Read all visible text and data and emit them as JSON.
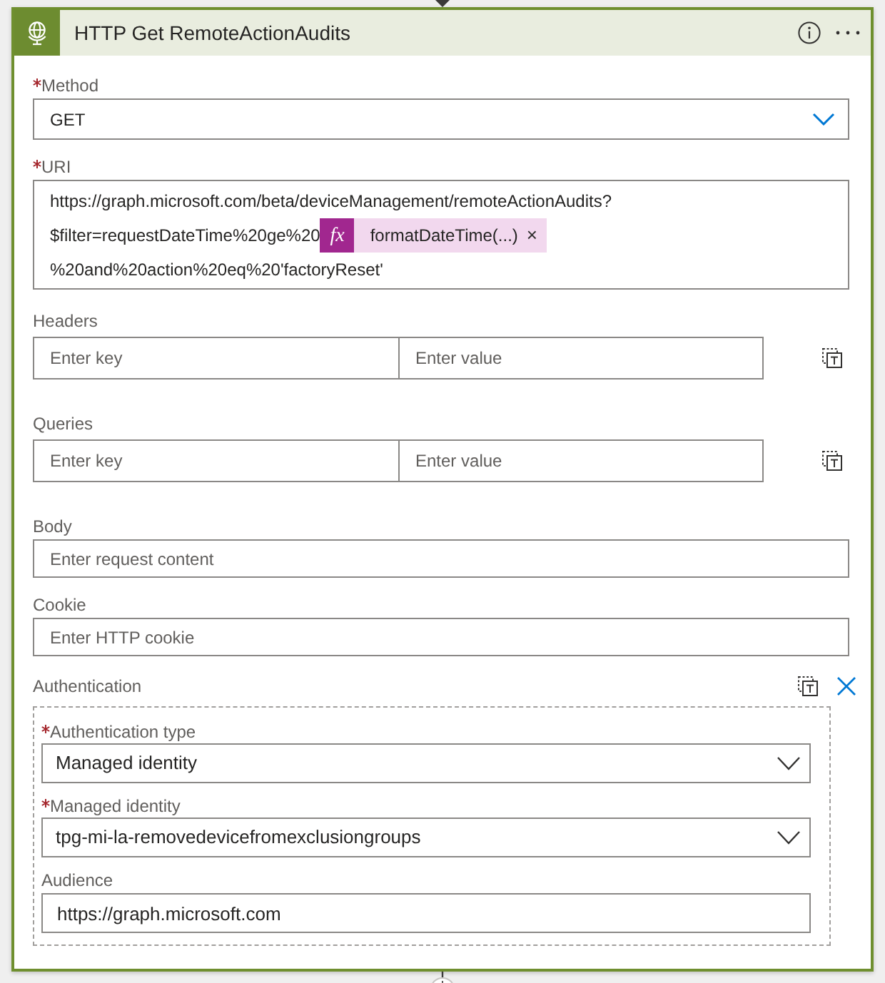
{
  "card": {
    "title": "HTTP Get RemoteActionAudits"
  },
  "fields": [
    {
      "kind": "combobox",
      "label": "Method",
      "required": true,
      "value": "GET"
    },
    {
      "kind": "expression",
      "label": "URI",
      "required": true,
      "lines": [
        [
          {
            "kind": "text",
            "text": "https://graph.microsoft.com/beta/deviceManagement/remoteActionAudits?"
          }
        ],
        [
          {
            "kind": "text",
            "text": "$filter=requestDateTime%20ge%20"
          },
          {
            "kind": "token",
            "symbol": "fx",
            "text": "formatDateTime(...)",
            "remove": "×"
          }
        ],
        [
          {
            "kind": "text",
            "text": "%20and%20action%20eq%20'factoryReset'"
          }
        ]
      ]
    },
    {
      "kind": "keyvalue",
      "label": "Headers",
      "required": false,
      "key_placeholder": "Enter key",
      "value_placeholder": "Enter value"
    },
    {
      "kind": "keyvalue",
      "label": "Queries",
      "required": false,
      "key_placeholder": "Enter key",
      "value_placeholder": "Enter value"
    },
    {
      "kind": "text",
      "label": "Body",
      "required": false,
      "placeholder": "Enter request content"
    },
    {
      "kind": "text",
      "label": "Cookie",
      "required": false,
      "placeholder": "Enter HTTP cookie"
    },
    {
      "kind": "group",
      "label": "Authentication",
      "fields": [
        {
          "kind": "dropdown",
          "label": "Authentication type",
          "required": true,
          "value": "Managed identity"
        },
        {
          "kind": "dropdown",
          "label": "Managed identity",
          "required": true,
          "value": "tpg-mi-la-removedevicefromexclusiongroups"
        },
        {
          "kind": "text",
          "label": "Audience",
          "required": false,
          "value": "https://graph.microsoft.com"
        }
      ]
    }
  ]
}
